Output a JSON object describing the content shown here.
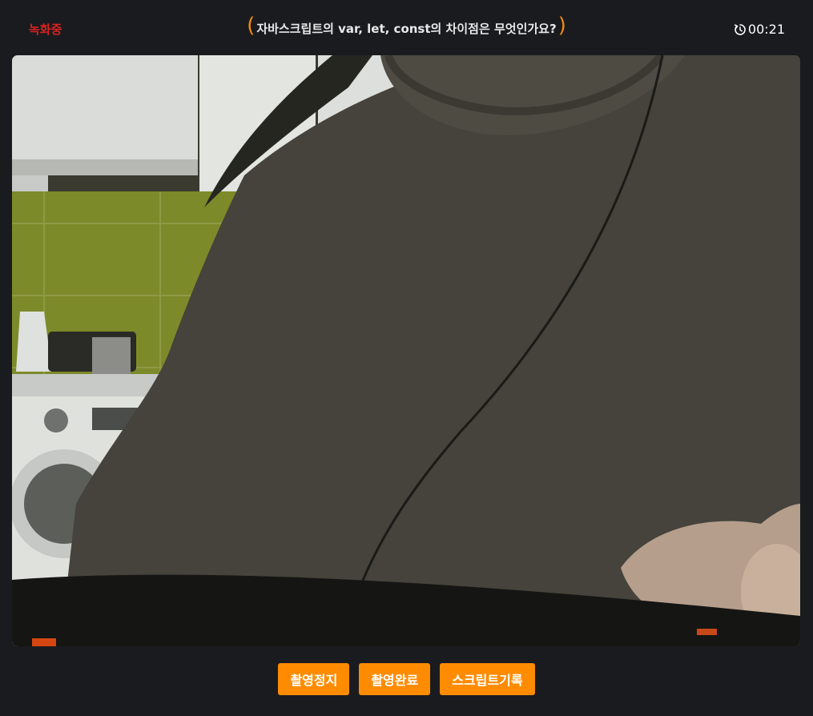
{
  "status": {
    "recording_label": "녹화중",
    "recording_color": "#d6231f"
  },
  "question": {
    "open_paren": "(",
    "text": "자바스크립트의 var, let, const의 차이점은 무엇인가요?",
    "close_paren": ")"
  },
  "timer": {
    "icon": "timer-reset-icon",
    "value": "00:21"
  },
  "video": {
    "content": "webcam-feed"
  },
  "controls": {
    "stop_label": "촬영정지",
    "complete_label": "촬영완료",
    "script_label": "스크립트기록"
  },
  "colors": {
    "background": "#1a1b1f",
    "accent": "#ff8c00",
    "paren_accent": "#f08a0c",
    "text": "#ffffff"
  }
}
